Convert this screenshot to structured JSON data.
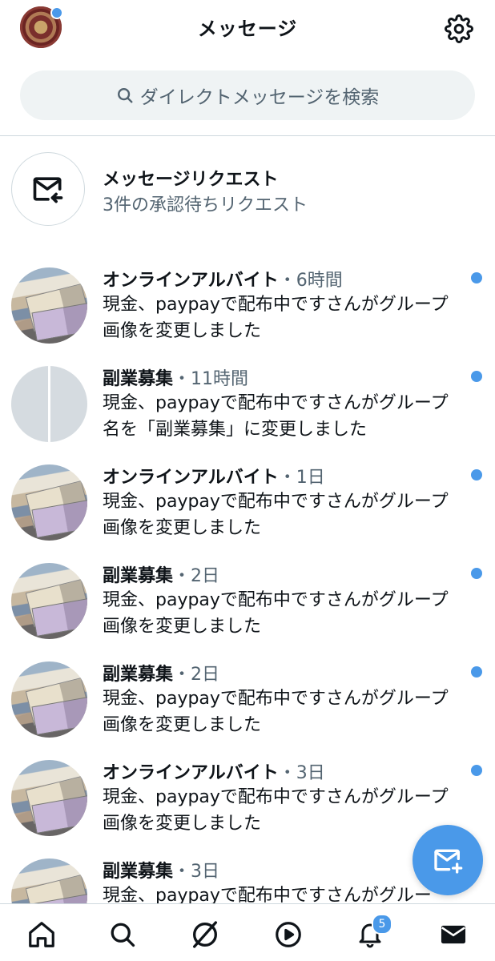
{
  "header": {
    "title": "メッセージ",
    "avatar_has_badge": true
  },
  "search": {
    "placeholder": "ダイレクトメッセージを検索"
  },
  "request": {
    "title": "メッセージリクエスト",
    "subtitle": "3件の承認待ちリクエスト"
  },
  "conversations": [
    {
      "name": "オンラインアルバイト",
      "time": "・6時間",
      "line1": "現金、paypayで配布中ですさんがグループ",
      "line2": "画像を変更しました",
      "avatar": "photo",
      "unread": true
    },
    {
      "name": "副業募集",
      "time": "・11時間",
      "line1": "現金、paypayで配布中ですさんがグループ",
      "line2": "名を「副業募集」に変更しました",
      "avatar": "group",
      "unread": true
    },
    {
      "name": "オンラインアルバイト",
      "time": "・1日",
      "line1": "現金、paypayで配布中ですさんがグループ",
      "line2": "画像を変更しました",
      "avatar": "photo",
      "unread": true
    },
    {
      "name": "副業募集",
      "time": "・2日",
      "line1": "現金、paypayで配布中ですさんがグループ",
      "line2": "画像を変更しました",
      "avatar": "photo",
      "unread": true
    },
    {
      "name": "副業募集",
      "time": "・2日",
      "line1": "現金、paypayで配布中ですさんがグループ",
      "line2": "画像を変更しました",
      "avatar": "photo",
      "unread": true
    },
    {
      "name": "オンラインアルバイト",
      "time": "・3日",
      "line1": "現金、paypayで配布中ですさんがグループ",
      "line2": "画像を変更しました",
      "avatar": "photo",
      "unread": true
    },
    {
      "name": "副業募集",
      "time": "・3日",
      "line1": "現金、paypayで配布中ですさんがグルー",
      "line2": "",
      "avatar": "photo",
      "unread": false
    }
  ],
  "tabbar": {
    "items": [
      "home-icon",
      "search-icon",
      "spaces-icon",
      "play-icon",
      "bell-icon",
      "mail-icon"
    ],
    "notification_count": "5",
    "active": "mail-icon"
  },
  "colors": {
    "accent": "#4a99e9",
    "text_primary": "#0f1419",
    "text_secondary": "#536471",
    "search_bg": "#eff3f4",
    "divider": "#cfd9de"
  }
}
